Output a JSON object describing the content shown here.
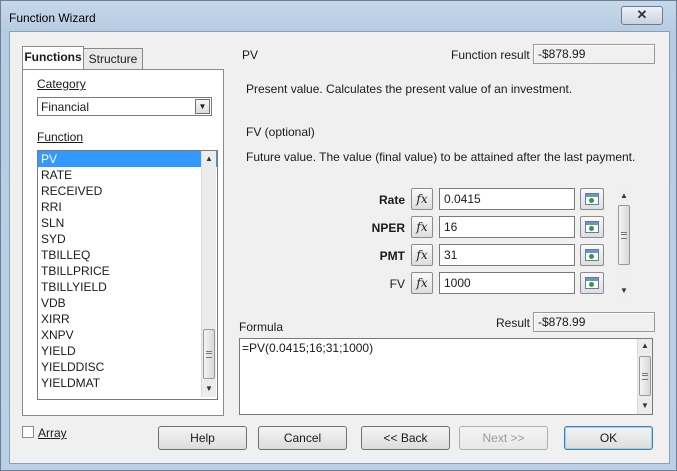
{
  "window": {
    "title": "Function Wizard",
    "close_glyph": "✕"
  },
  "tabs": [
    "Functions",
    "Structure"
  ],
  "category": {
    "label": "Category",
    "value": "Financial"
  },
  "function_list": {
    "label": "Function",
    "items": [
      "PV",
      "RATE",
      "RECEIVED",
      "RRI",
      "SLN",
      "SYD",
      "TBILLEQ",
      "TBILLPRICE",
      "TBILLYIELD",
      "VDB",
      "XIRR",
      "XNPV",
      "YIELD",
      "YIELDDISC",
      "YIELDMAT"
    ],
    "selected": "PV"
  },
  "details": {
    "function_name": "PV",
    "function_result_label": "Function result",
    "function_result_value": "-$878.99",
    "description": "Present value. Calculates the present value of an investment.",
    "param_name": "FV (optional)",
    "param_description": "Future value. The value (final value) to be attained after the last payment."
  },
  "arguments": [
    {
      "label": "Rate",
      "required": true,
      "value": "0.0415"
    },
    {
      "label": "NPER",
      "required": true,
      "value": "16"
    },
    {
      "label": "PMT",
      "required": true,
      "value": "31"
    },
    {
      "label": "FV",
      "required": false,
      "value": "1000"
    }
  ],
  "fx_glyph": "fx",
  "formula": {
    "label": "Formula",
    "result_label": "Result",
    "result_value": "-$878.99",
    "text": "=PV(0.0415;16;31;1000)"
  },
  "array_label": "Array",
  "buttons": {
    "help": "Help",
    "back": "<< Back",
    "cancel": "Cancel",
    "next": "Next >>",
    "ok": "OK"
  }
}
